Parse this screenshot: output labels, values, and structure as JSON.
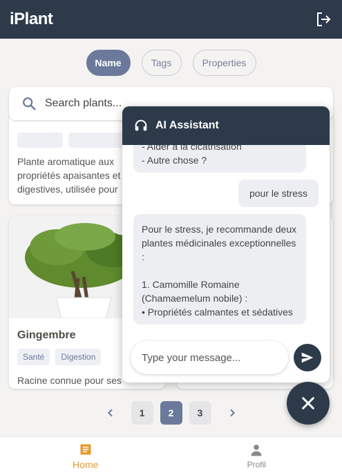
{
  "app": {
    "title": "iPlant"
  },
  "segments": [
    {
      "label": "Name",
      "active": true
    },
    {
      "label": "Tags",
      "active": false
    },
    {
      "label": "Properties",
      "active": false
    }
  ],
  "search": {
    "placeholder": "Search plants..."
  },
  "cards": {
    "top_left": {
      "description": "Plante aromatique aux propriétés apaisantes et digestives, utilisée pour"
    },
    "bottom_left": {
      "name": "Gingembre",
      "tags": [
        "Santé",
        "Digestion"
      ],
      "description": "Racine connue pour ses"
    }
  },
  "chat": {
    "title": "AI Assistant",
    "messages": [
      {
        "role": "bot",
        "text": "- Aider à la cicatrisation\n- Autre chose ?"
      },
      {
        "role": "user",
        "text": "pour le stress"
      },
      {
        "role": "bot",
        "text": "Pour le stress, je recommande deux plantes médicinales exceptionnelles :\n\n1. Camomille Romaine (Chamaemelum nobile) :\n• Propriétés calmantes et sédatives"
      }
    ],
    "input_placeholder": "Type your message..."
  },
  "pagination": {
    "pages": [
      "1",
      "2",
      "3"
    ],
    "current": "2"
  },
  "bottom_nav": [
    {
      "label": "Home",
      "icon": "article-icon",
      "active": true
    },
    {
      "label": "Profil",
      "icon": "person-icon",
      "active": false
    }
  ],
  "colors": {
    "primary": "#2c3a4a",
    "accent": "#e7992a",
    "active_chip": "#6b7a9b"
  }
}
